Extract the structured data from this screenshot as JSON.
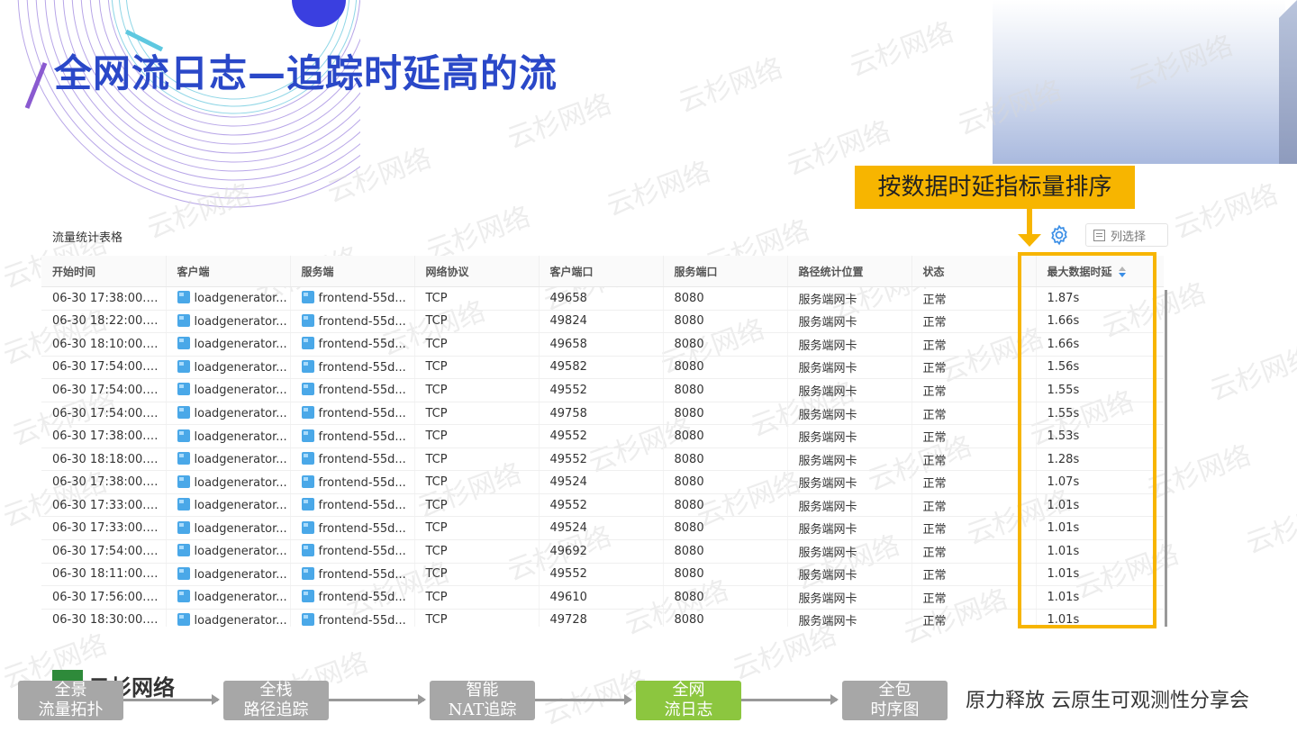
{
  "slide": {
    "title": "全网流日志—追踪时延高的流",
    "callout": "按数据时延指标量排序"
  },
  "table": {
    "title": "流量统计表格",
    "column_select_label": "列选择",
    "columns": [
      "开始时间",
      "客户端",
      "服务端",
      "网络协议",
      "客户端口",
      "服务端口",
      "路径统计位置",
      "状态",
      "最大数据时延"
    ],
    "sorted_column": "最大数据时延",
    "rows": [
      [
        "06-30 17:38:00.000",
        "loadgenerator...",
        "frontend-55d...",
        "TCP",
        "49658",
        "8080",
        "服务端网卡",
        "正常",
        "1.87s"
      ],
      [
        "06-30 18:22:00.000",
        "loadgenerator...",
        "frontend-55d...",
        "TCP",
        "49824",
        "8080",
        "服务端网卡",
        "正常",
        "1.66s"
      ],
      [
        "06-30 18:10:00.000",
        "loadgenerator...",
        "frontend-55d...",
        "TCP",
        "49658",
        "8080",
        "服务端网卡",
        "正常",
        "1.66s"
      ],
      [
        "06-30 17:54:00.000",
        "loadgenerator...",
        "frontend-55d...",
        "TCP",
        "49582",
        "8080",
        "服务端网卡",
        "正常",
        "1.56s"
      ],
      [
        "06-30 17:54:00.000",
        "loadgenerator...",
        "frontend-55d...",
        "TCP",
        "49552",
        "8080",
        "服务端网卡",
        "正常",
        "1.55s"
      ],
      [
        "06-30 17:54:00.000",
        "loadgenerator...",
        "frontend-55d...",
        "TCP",
        "49758",
        "8080",
        "服务端网卡",
        "正常",
        "1.55s"
      ],
      [
        "06-30 17:38:00.000",
        "loadgenerator...",
        "frontend-55d...",
        "TCP",
        "49552",
        "8080",
        "服务端网卡",
        "正常",
        "1.53s"
      ],
      [
        "06-30 18:18:00.000",
        "loadgenerator...",
        "frontend-55d...",
        "TCP",
        "49552",
        "8080",
        "服务端网卡",
        "正常",
        "1.28s"
      ],
      [
        "06-30 17:38:00.000",
        "loadgenerator...",
        "frontend-55d...",
        "TCP",
        "49524",
        "8080",
        "服务端网卡",
        "正常",
        "1.07s"
      ],
      [
        "06-30 17:33:00.000",
        "loadgenerator...",
        "frontend-55d...",
        "TCP",
        "49552",
        "8080",
        "服务端网卡",
        "正常",
        "1.01s"
      ],
      [
        "06-30 17:33:00.000",
        "loadgenerator...",
        "frontend-55d...",
        "TCP",
        "49524",
        "8080",
        "服务端网卡",
        "正常",
        "1.01s"
      ],
      [
        "06-30 17:54:00.000",
        "loadgenerator...",
        "frontend-55d...",
        "TCP",
        "49692",
        "8080",
        "服务端网卡",
        "正常",
        "1.01s"
      ],
      [
        "06-30 18:11:00.000",
        "loadgenerator...",
        "frontend-55d...",
        "TCP",
        "49552",
        "8080",
        "服务端网卡",
        "正常",
        "1.01s"
      ],
      [
        "06-30 17:56:00.000",
        "loadgenerator...",
        "frontend-55d...",
        "TCP",
        "49610",
        "8080",
        "服务端网卡",
        "正常",
        "1.01s"
      ],
      [
        "06-30 18:30:00.000",
        "loadgenerator...",
        "frontend-55d...",
        "TCP",
        "49728",
        "8080",
        "服务端网卡",
        "正常",
        "1.01s"
      ]
    ]
  },
  "footer": {
    "logo_text": "云杉网络",
    "steps": [
      {
        "line1": "全景",
        "line2": "流量拓扑"
      },
      {
        "line1": "全栈",
        "line2": "路径追踪"
      },
      {
        "line1": "智能",
        "line2": "NAT追踪"
      },
      {
        "line1": "全网",
        "line2": "流日志"
      },
      {
        "line1": "全包",
        "line2": "时序图"
      }
    ],
    "active_step": 3,
    "slogan": "原力释放 云原生可观测性分享会"
  },
  "watermark": "云杉网络",
  "colors": {
    "title": "#2a48c8",
    "highlight": "#f7b500",
    "active_step": "#8cc63f",
    "inactive_step": "#a7a7a7"
  }
}
